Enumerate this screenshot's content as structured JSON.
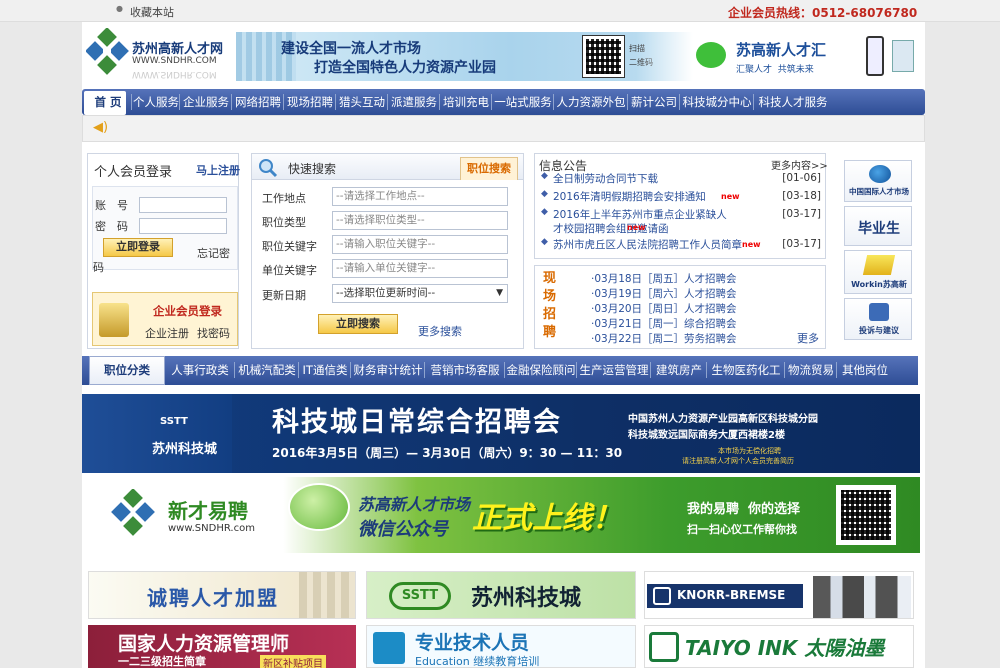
{
  "topbar": {
    "bookmark": "收藏本站",
    "hotline": "企业会员热线：0512-68076780"
  },
  "header": {
    "logo_cn": "苏州高新人才网",
    "logo_en": "WWW.SNDHR.COM",
    "banner_line1": "建设全国一流人才市场",
    "banner_line2": "打造全国特色人力资源产业园",
    "qr_caption_1": "扫描",
    "qr_caption_2": "二维码",
    "wechat_brand": "苏高新人才汇",
    "wechat_slogan": "汇聚人才  共筑未来"
  },
  "nav": [
    "首 页",
    "个人服务",
    "企业服务",
    "网络招聘",
    "现场招聘",
    "猎头互动",
    "派遣服务",
    "培训充电",
    "一站式服务",
    "人力资源外包",
    "薪计公司",
    "科技城分中心",
    "科技人才服务"
  ],
  "login": {
    "title": "个人会员登录",
    "register": "马上注册",
    "account_label": "账　号",
    "password_label": "密　码",
    "submit": "立即登录",
    "forgot": "忘记密码",
    "corp_title": "企业会员登录",
    "corp_register": "企业注册",
    "corp_forgot": "找密码"
  },
  "search": {
    "title": "快速搜索",
    "tab": "职位搜索",
    "rows": [
      {
        "label": "工作地点",
        "placeholder": "--请选择工作地点--"
      },
      {
        "label": "职位类型",
        "placeholder": "--请选择职位类型--"
      },
      {
        "label": "职位关键字",
        "placeholder": "--请输入职位关键字--"
      },
      {
        "label": "单位关键字",
        "placeholder": "--请输入单位关键字--"
      }
    ],
    "date_label": "更新日期",
    "date_value": "--选择职位更新时间--",
    "submit": "立即搜索",
    "more": "更多搜索"
  },
  "notice": {
    "title": "信息公告",
    "more": "更多内容>>",
    "items": [
      {
        "text": "全日制劳动合同节下载",
        "date": "[01-06]",
        "new": false
      },
      {
        "text": "2016年清明假期招聘会安排通知",
        "date": "[03-18]",
        "new": true
      },
      {
        "text": "2016年上半年苏州市重点企业紧缺人才校园招聘会组团邀请函",
        "date": "[03-17]",
        "new": true
      },
      {
        "text": "苏州市虎丘区人民法院招聘工作人员简章",
        "date": "[03-17]",
        "new": true
      }
    ],
    "new_tag": "new"
  },
  "events": {
    "title": "现场招聘",
    "more": "更多",
    "items": [
      "·03月18日［周五］人才招聘会",
      "·03月19日［周六］人才招聘会",
      "·03月20日［周日］人才招聘会",
      "·03月21日［周一］综合招聘会",
      "·03月22日［周二］劳务招聘会"
    ]
  },
  "sidebar": [
    "中国国际人才市场",
    "毕业生",
    "Workin苏高新",
    "投诉与建议"
  ],
  "categories": [
    "职位分类",
    "人事行政类",
    "机械汽配类",
    "IT通信类",
    "财务审计统计",
    "营销市场客服",
    "金融保险顾问",
    "生产运营管理",
    "建筑房产",
    "生物医药化工",
    "物流贸易",
    "其他岗位"
  ],
  "ad1": {
    "logo": "SSTT",
    "logo_cn": "苏州科技城",
    "title": "科技城日常综合招聘会",
    "date": "2016年3月5日（周三）— 3月30日（周六）9：30 — 11：30",
    "org1": "中国苏州人力资源产业园高新区科技城分园",
    "org2": "科技城致远国际商务大厦西裙楼2楼",
    "note1": "本市场为无偿化招聘",
    "note2": "请注册高新人才网个人会员完善简历"
  },
  "ad2": {
    "brand": "新才易聘",
    "url": "www.SNDHR.com",
    "line1": "苏高新人才市场",
    "line2": "微信公众号",
    "launch": "正式上线！",
    "slogan1": "我的易聘  你的选择",
    "slogan2": "扫一扫心仪工作帮你找"
  },
  "tiles": [
    {
      "text": "诚聘人才加盟"
    },
    {
      "text": "苏州科技城",
      "logo": "SSTT"
    },
    {
      "text": "KNORR-BREMSE"
    },
    {
      "text": "国家人力资源管理师",
      "sub": "一二三级招生简章",
      "tag": "新区补贴项目"
    },
    {
      "text": "专业技术人员",
      "sub": "Education 继续教育培训"
    },
    {
      "text": "TAIYO INK 太陽油墨"
    }
  ],
  "colors": {
    "nav": "#3f5ea8",
    "orange": "#d96a00",
    "hotline_red": "#c0281e",
    "link_blue": "#2a4f9a"
  }
}
